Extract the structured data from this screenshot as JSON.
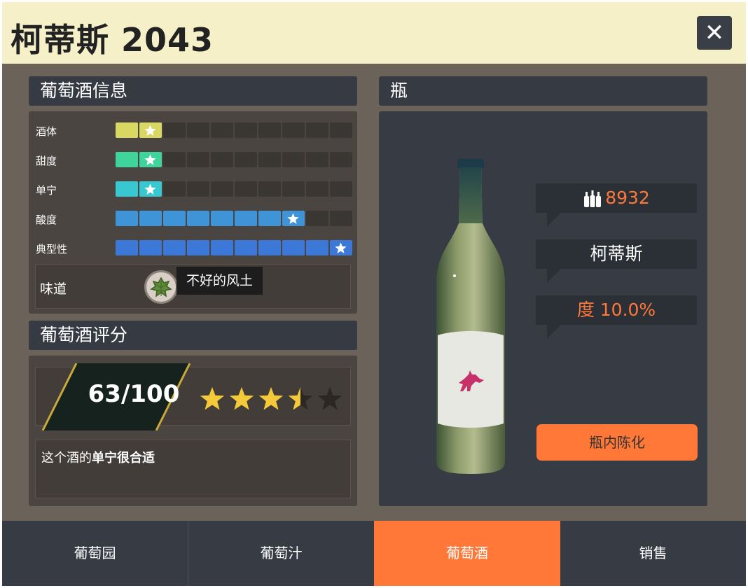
{
  "header": {
    "title": "柯蒂斯 2043",
    "close_icon": "close-icon"
  },
  "wine_info": {
    "header": "葡萄酒信息",
    "segments_total": 10,
    "attributes": [
      {
        "label": "酒体",
        "level": 2,
        "color": "#d8d862"
      },
      {
        "label": "甜度",
        "level": 2,
        "color": "#3fd49a"
      },
      {
        "label": "单宁",
        "level": 2,
        "color": "#37c8d2"
      },
      {
        "label": "酸度",
        "level": 8,
        "color": "#3f94d8"
      },
      {
        "label": "典型性",
        "level": 10,
        "color": "#3c78d8"
      }
    ],
    "taste_label": "味道",
    "taste_icon": "grape-leaf-icon",
    "taste_tooltip": "不好的风土"
  },
  "wine_rating": {
    "header": "葡萄酒评分",
    "score": "63/100",
    "stars": 3.5,
    "stars_max": 5,
    "comment_prefix": "这个酒的",
    "comment_bold": "单宁很合适"
  },
  "bottle": {
    "header": "瓶",
    "count_icon": "bottles-icon",
    "count": "8932",
    "name": "柯蒂斯",
    "alcohol": "度 10.0%",
    "age_button": "瓶内陈化",
    "label_icon": "fox-icon"
  },
  "tabs": [
    {
      "label": "葡萄园",
      "active": false
    },
    {
      "label": "葡萄汁",
      "active": false
    },
    {
      "label": "葡萄酒",
      "active": true
    },
    {
      "label": "销售",
      "active": false
    }
  ],
  "colors": {
    "accent": "#ff7838",
    "highlight_text": "#ff7838"
  }
}
